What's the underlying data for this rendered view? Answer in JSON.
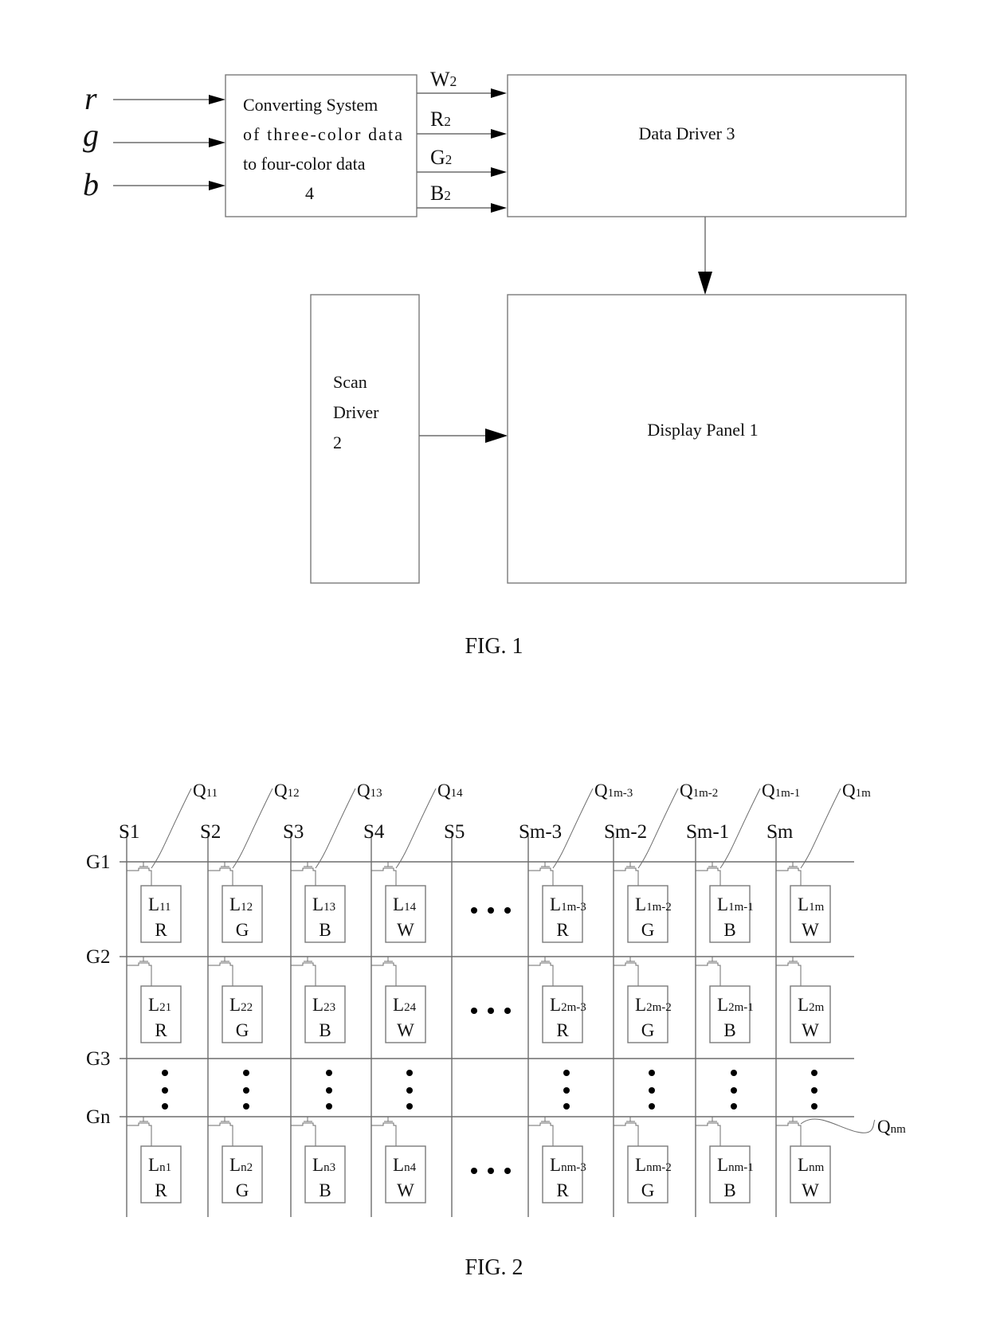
{
  "fig1": {
    "caption": "FIG. 1",
    "inputs": [
      "r",
      "g",
      "b"
    ],
    "converter": {
      "lines": [
        "Converting System",
        "of three-color data",
        "to four-color data",
        "4"
      ]
    },
    "outputs": [
      {
        "main": "W",
        "sub": "2"
      },
      {
        "main": "R",
        "sub": "2"
      },
      {
        "main": "G",
        "sub": "2"
      },
      {
        "main": "B",
        "sub": "2"
      }
    ],
    "data_driver": {
      "label": "Data Driver 3"
    },
    "scan_driver": {
      "lines": [
        "Scan",
        "Driver",
        "2"
      ]
    },
    "display_panel": {
      "label": "Display Panel 1"
    }
  },
  "fig2": {
    "caption": "FIG. 2",
    "source_lines": [
      "S1",
      "S2",
      "S3",
      "S4",
      "S5",
      "Sm-3",
      "Sm-2",
      "Sm-1",
      "Sm"
    ],
    "gate_lines": [
      "G1",
      "G2",
      "G3",
      "Gn"
    ],
    "transistor_labels_row1": [
      {
        "main": "Q",
        "sub": "11"
      },
      {
        "main": "Q",
        "sub": "12"
      },
      {
        "main": "Q",
        "sub": "13"
      },
      {
        "main": "Q",
        "sub": "14"
      },
      {
        "main": "Q",
        "sub": "1m-3"
      },
      {
        "main": "Q",
        "sub": "1m-2"
      },
      {
        "main": "Q",
        "sub": "1m-1"
      },
      {
        "main": "Q",
        "sub": "1m"
      }
    ],
    "transistor_label_last": {
      "main": "Q",
      "sub": "nm"
    },
    "rows": [
      {
        "cells": [
          {
            "main": "L",
            "sub": "11",
            "color": "R"
          },
          {
            "main": "L",
            "sub": "12",
            "color": "G"
          },
          {
            "main": "L",
            "sub": "13",
            "color": "B"
          },
          {
            "main": "L",
            "sub": "14",
            "color": "W"
          },
          {
            "main": "L",
            "sub": "1m-3",
            "color": "R"
          },
          {
            "main": "L",
            "sub": "1m-2",
            "color": "G"
          },
          {
            "main": "L",
            "sub": "1m-1",
            "color": "B"
          },
          {
            "main": "L",
            "sub": "1m",
            "color": "W"
          }
        ]
      },
      {
        "cells": [
          {
            "main": "L",
            "sub": "21",
            "color": "R"
          },
          {
            "main": "L",
            "sub": "22",
            "color": "G"
          },
          {
            "main": "L",
            "sub": "23",
            "color": "B"
          },
          {
            "main": "L",
            "sub": "24",
            "color": "W"
          },
          {
            "main": "L",
            "sub": "2m-3",
            "color": "R"
          },
          {
            "main": "L",
            "sub": "2m-2",
            "color": "G"
          },
          {
            "main": "L",
            "sub": "2m-1",
            "color": "B"
          },
          {
            "main": "L",
            "sub": "2m",
            "color": "W"
          }
        ]
      },
      {
        "cells": [
          {
            "main": "L",
            "sub": "n1",
            "color": "R"
          },
          {
            "main": "L",
            "sub": "n2",
            "color": "G"
          },
          {
            "main": "L",
            "sub": "n3",
            "color": "B"
          },
          {
            "main": "L",
            "sub": "n4",
            "color": "W"
          },
          {
            "main": "L",
            "sub": "nm-3",
            "color": "R"
          },
          {
            "main": "L",
            "sub": "nm-2",
            "color": "G"
          },
          {
            "main": "L",
            "sub": "nm-1",
            "color": "B"
          },
          {
            "main": "L",
            "sub": "nm",
            "color": "W"
          }
        ]
      }
    ]
  }
}
